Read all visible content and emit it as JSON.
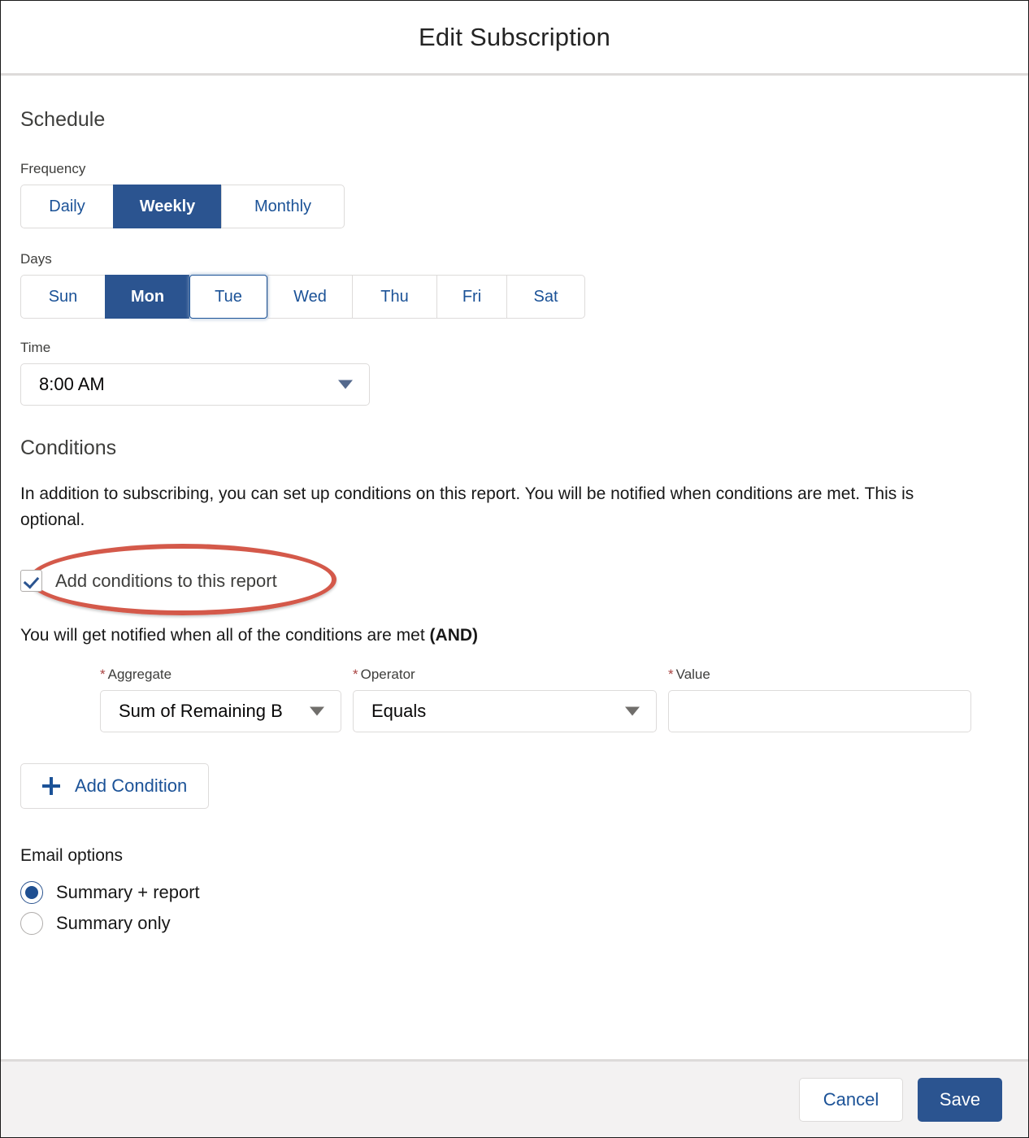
{
  "header": {
    "title": "Edit Subscription"
  },
  "schedule": {
    "section_title": "Schedule",
    "frequency": {
      "label": "Frequency",
      "options": [
        "Daily",
        "Weekly",
        "Monthly"
      ],
      "selected": "Weekly"
    },
    "days": {
      "label": "Days",
      "options": [
        "Sun",
        "Mon",
        "Tue",
        "Wed",
        "Thu",
        "Fri",
        "Sat"
      ],
      "selected": "Mon",
      "focused": "Tue"
    },
    "time": {
      "label": "Time",
      "value": "8:00 AM"
    }
  },
  "conditions": {
    "section_title": "Conditions",
    "description": "In addition to subscribing, you can set up conditions on this report. You will be notified when conditions are met. This is optional.",
    "add_conditions_checkbox": {
      "label": "Add conditions to this report",
      "checked": true,
      "annotation_color": "#d4594a"
    },
    "and_text_prefix": "You will get notified when all of the conditions are met ",
    "and_text_bold": "(AND)",
    "row": {
      "aggregate": {
        "label": "Aggregate",
        "required_marker": "*",
        "value": "Sum of Remaining B"
      },
      "operator": {
        "label": "Operator",
        "required_marker": "*",
        "value": "Equals"
      },
      "value_field": {
        "label": "Value",
        "required_marker": "*",
        "value": "",
        "placeholder": ""
      }
    },
    "add_condition_button": "Add Condition"
  },
  "email_options": {
    "title": "Email options",
    "options": [
      {
        "label": "Summary + report",
        "selected": true
      },
      {
        "label": "Summary only",
        "selected": false
      }
    ]
  },
  "footer": {
    "cancel_label": "Cancel",
    "save_label": "Save"
  },
  "colors": {
    "accent_blue": "#2b5490",
    "link_blue": "#1b5297",
    "annotation_red": "#d4594a",
    "border_gray": "#dddbda",
    "footer_bg": "#f3f2f2"
  }
}
